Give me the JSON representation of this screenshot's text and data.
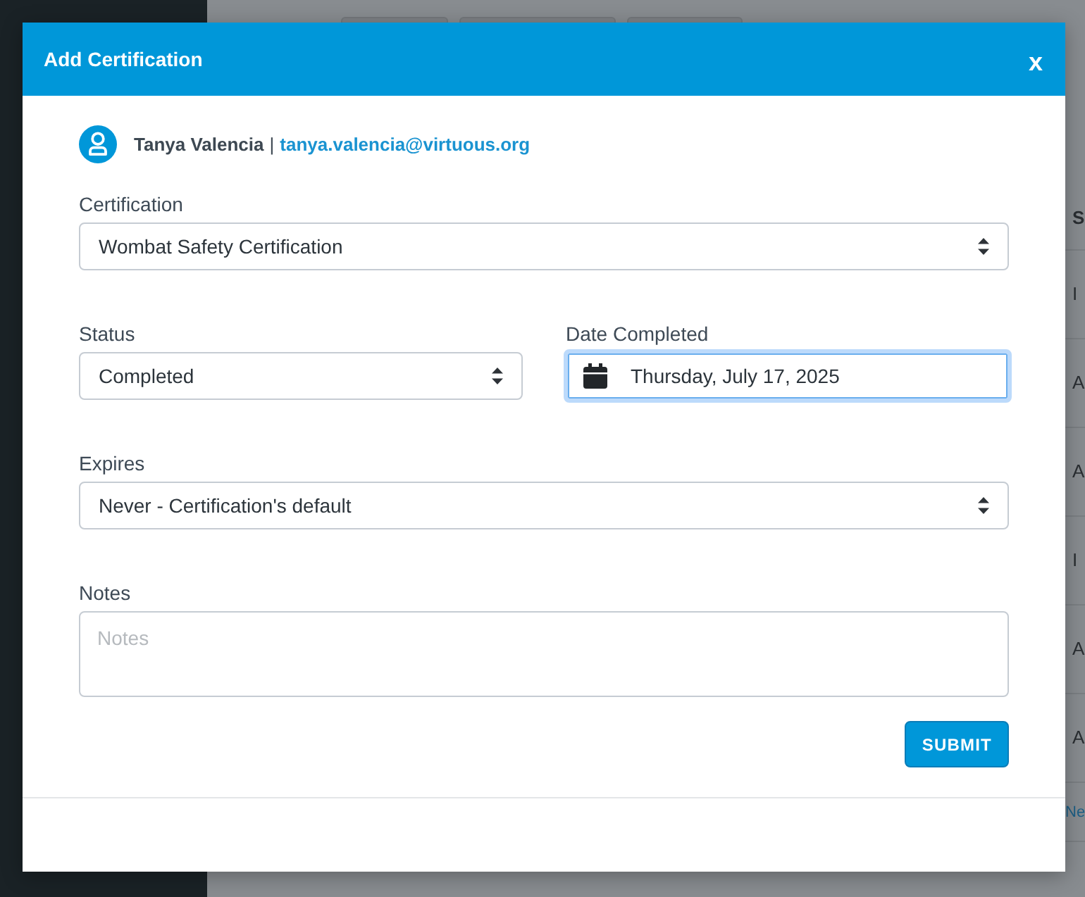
{
  "background_page": {
    "table": {
      "columns": [
        {
          "header": "S",
          "cells": [
            "I",
            "A",
            "A",
            "I",
            "A",
            "A"
          ]
        }
      ]
    },
    "pagination_link": "Ne"
  },
  "modal": {
    "title": "Add Certification",
    "close": "x",
    "user": {
      "name": "Tanya Valencia",
      "separator": "|",
      "email": "tanya.valencia@virtuous.org"
    },
    "form": {
      "rows": [
        {
          "fields": [
            {
              "kind": "select",
              "label": "Certification",
              "value": "Wombat Safety Certification",
              "focused": false
            }
          ]
        },
        {
          "fields": [
            {
              "kind": "select",
              "label": "Status",
              "value": "Completed",
              "focused": false
            },
            {
              "kind": "date",
              "label": "Date Completed",
              "value": "Thursday, July 17, 2025",
              "focused": true
            }
          ]
        },
        {
          "fields": [
            {
              "kind": "select",
              "label": "Expires",
              "value": "Never - Certification's default",
              "focused": false
            }
          ]
        },
        {
          "fields": [
            {
              "kind": "textarea",
              "label": "Notes",
              "placeholder": "Notes",
              "focused": false
            }
          ]
        }
      ],
      "submit_button": {
        "label": "SUBMIT"
      }
    }
  }
}
